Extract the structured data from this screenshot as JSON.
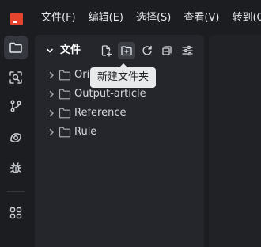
{
  "titlebar": {
    "logo_icon": "app-logo-icon",
    "menus": [
      {
        "label": "文件(F)"
      },
      {
        "label": "编辑(E)"
      },
      {
        "label": "选择(S)"
      },
      {
        "label": "查看(V)"
      },
      {
        "label": "转到(G)"
      }
    ]
  },
  "activity_bar": {
    "items": [
      {
        "name": "explorer",
        "icon": "files-icon",
        "active": true
      },
      {
        "name": "search",
        "icon": "scan-search-icon"
      },
      {
        "name": "source-control",
        "icon": "git-branch-icon"
      },
      {
        "name": "preview",
        "icon": "eye-icon"
      },
      {
        "name": "debug",
        "icon": "bug-icon"
      },
      {
        "name": "extensions",
        "icon": "grid-icon"
      }
    ]
  },
  "explorer": {
    "title": "文件",
    "toolbar": [
      {
        "name": "new-file",
        "icon": "file-plus-icon"
      },
      {
        "name": "new-folder",
        "icon": "folder-plus-icon",
        "hovered": true
      },
      {
        "name": "refresh",
        "icon": "refresh-icon"
      },
      {
        "name": "collapse-all",
        "icon": "collapse-all-icon"
      },
      {
        "name": "settings",
        "icon": "sliders-icon"
      }
    ],
    "tree": [
      {
        "label": "Orig"
      },
      {
        "label": "Output-article"
      },
      {
        "label": "Reference"
      },
      {
        "label": "Rule"
      }
    ]
  },
  "tooltip": {
    "text": "新建文件夹"
  },
  "colors": {
    "background": "#1b1d21",
    "panel": "#24262b",
    "accent": "#e5452f",
    "tooltip_bg": "#e8e9eb"
  }
}
